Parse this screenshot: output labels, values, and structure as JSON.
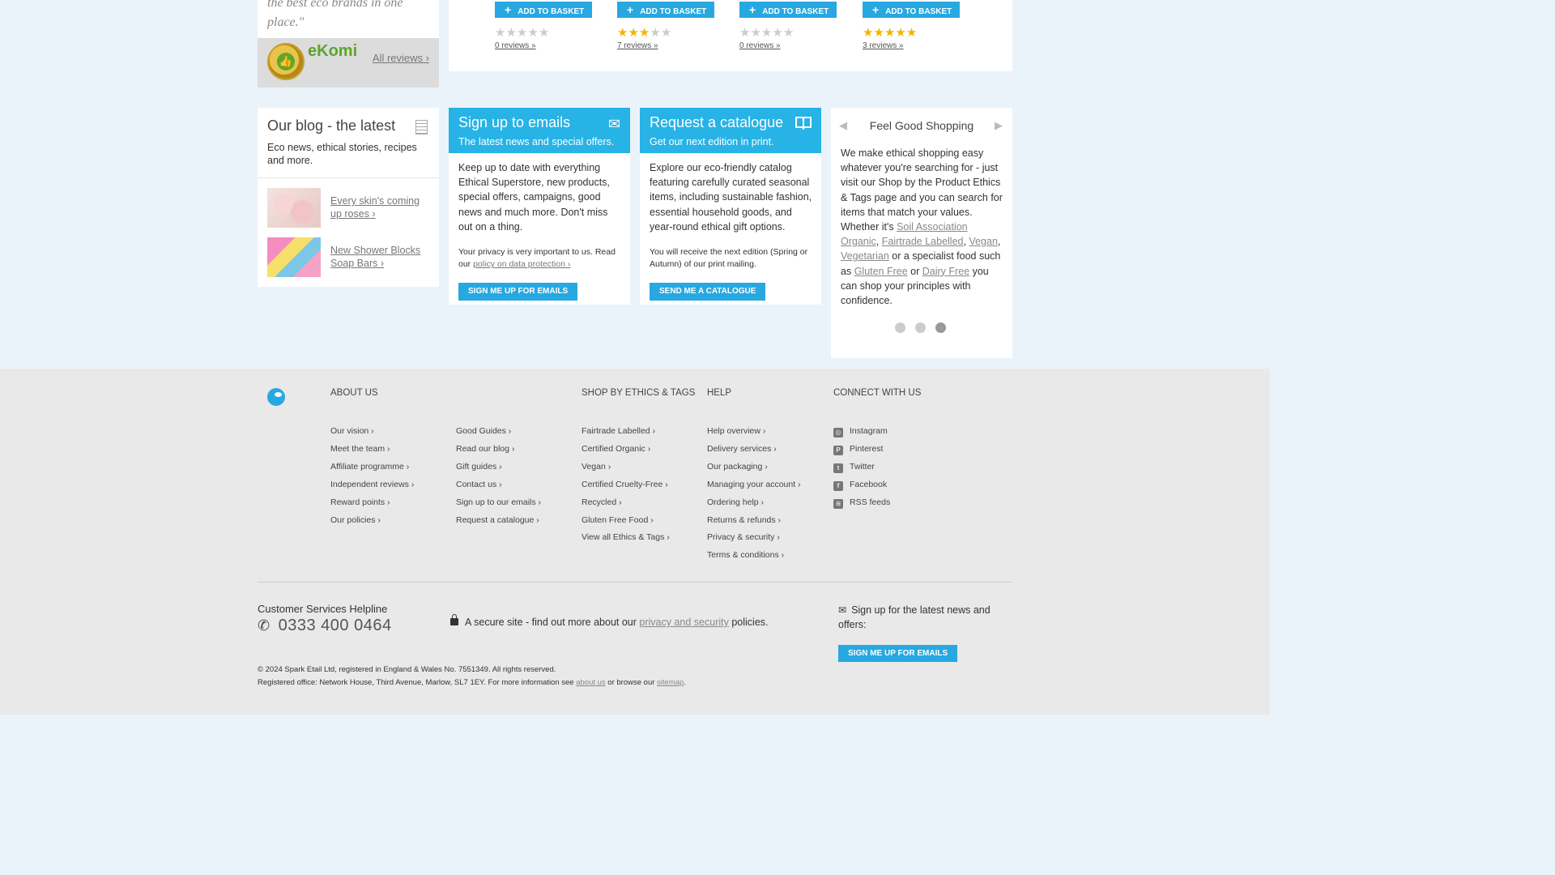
{
  "review": {
    "quote": "the best eco brands in one place.\"",
    "ekomi_label": "eKomi",
    "seal_text": "eKomi",
    "all_reviews": "All reviews ›"
  },
  "products": [
    {
      "basket_label": "ADD TO BASKET",
      "rating": 0,
      "reviews": "0 reviews »"
    },
    {
      "basket_label": "ADD TO BASKET",
      "rating": 3,
      "reviews": "7 reviews »"
    },
    {
      "basket_label": "ADD TO BASKET",
      "rating": 0,
      "reviews": "0 reviews »"
    },
    {
      "basket_label": "ADD TO BASKET",
      "rating": 5,
      "reviews": "3 reviews »"
    }
  ],
  "blog": {
    "title": "Our blog - the latest",
    "desc": "Eco news, ethical stories, recipes and more.",
    "items": [
      {
        "label": "Every skin's coming up roses ›"
      },
      {
        "label": "New Shower Blocks Soap Bars ›"
      }
    ]
  },
  "email_card": {
    "title": "Sign up to emails",
    "subtitle": "The latest news and special offers.",
    "body": "Keep up to date with everything Ethical Superstore, new products, special offers, campaigns, good news and much more. Don't miss out on a thing.",
    "privacy_prefix": "Your privacy is very important to us. Read our ",
    "privacy_link": "policy on data protection ›",
    "button": "SIGN ME UP FOR EMAILS"
  },
  "catalogue_card": {
    "title": "Request a catalogue",
    "subtitle": "Get our next edition in print.",
    "body": "Explore our eco-friendly catalog featuring carefully curated seasonal items, including sustainable fashion, essential household goods, and year-round ethical gift options.",
    "note": "You will receive the next edition (Spring or Autumn) of our print mailing.",
    "button": "SEND ME A CATALOGUE"
  },
  "fgs": {
    "title": "Feel Good Shopping",
    "prev": "◀",
    "next": "▶",
    "intro": "We make ethical shopping easy whatever you're searching for - just visit our Shop by the Product Ethics & Tags page and you can search for items that match your values. Whether it's ",
    "link1": "Soil Association Organic",
    "sep1": ", ",
    "link2": "Fairtrade Labelled",
    "sep2": ", ",
    "link3": "Vegan",
    "sep3": ", ",
    "link4": "Vegetarian",
    "mid": " or a specialist food such as ",
    "link5": "Gluten Free",
    "or": " or ",
    "link6": "Dairy Free",
    "outro": " you can shop your principles with confidence.",
    "active_slide": 3
  },
  "footer": {
    "about_head": "ABOUT US",
    "about_links": [
      "Our vision ›",
      "Meet the team ›",
      "Affiliate programme ›",
      "Independent reviews ›",
      "Reward points ›",
      "Our policies ›"
    ],
    "about_links2": [
      "Good Guides ›",
      "Read our blog ›",
      "Gift guides ›",
      "Contact us ›",
      "Sign up to our emails ›",
      "Request a catalogue ›"
    ],
    "ethics_head": "SHOP BY ETHICS & TAGS",
    "ethics_links": [
      "Fairtrade Labelled ›",
      "Certified Organic ›",
      "Vegan ›",
      "Certified Cruelty-Free ›",
      "Recycled ›",
      "Gluten Free Food ›",
      "View all Ethics & Tags ›"
    ],
    "help_head": "HELP",
    "help_links": [
      "Help overview ›",
      "Delivery services ›",
      "Our packaging ›",
      "Managing your account ›",
      "Ordering help ›",
      "Returns & refunds ›",
      "Privacy & security ›",
      "Terms & conditions ›"
    ],
    "connect_head": "CONNECT WITH US",
    "social": [
      {
        "label": "Instagram",
        "icon": "instagram-icon",
        "glyph": "◎"
      },
      {
        "label": "Pinterest",
        "icon": "pinterest-icon",
        "glyph": "P"
      },
      {
        "label": "Twitter",
        "icon": "twitter-icon",
        "glyph": "t"
      },
      {
        "label": "Facebook",
        "icon": "facebook-icon",
        "glyph": "f"
      },
      {
        "label": "RSS feeds",
        "icon": "rss-icon",
        "glyph": "≋"
      }
    ],
    "helpline_label": "Customer Services Helpline",
    "phone": "0333 400 0464",
    "secure_prefix": "A secure site - find out more about our ",
    "secure_link": "privacy and security",
    "secure_suffix": " policies.",
    "signup_text": "Sign up for the latest news and offers:",
    "signup_button": "SIGN ME UP FOR EMAILS",
    "copyright": "© 2024 Spark Etail Ltd, registered in England & Wales No. 7551349. All rights reserved.",
    "registered_prefix": "Registered office: Network House, Third Avenue, Marlow, SL7 1EY. For more information see ",
    "about_link": "about us",
    "browse_text": " or browse our ",
    "sitemap_link": "sitemap",
    "period": "."
  },
  "colors": {
    "accent": "#27a8e0",
    "card_blue": "#27b3e6",
    "star": "#f4b400",
    "background": "#eaf3fa"
  }
}
